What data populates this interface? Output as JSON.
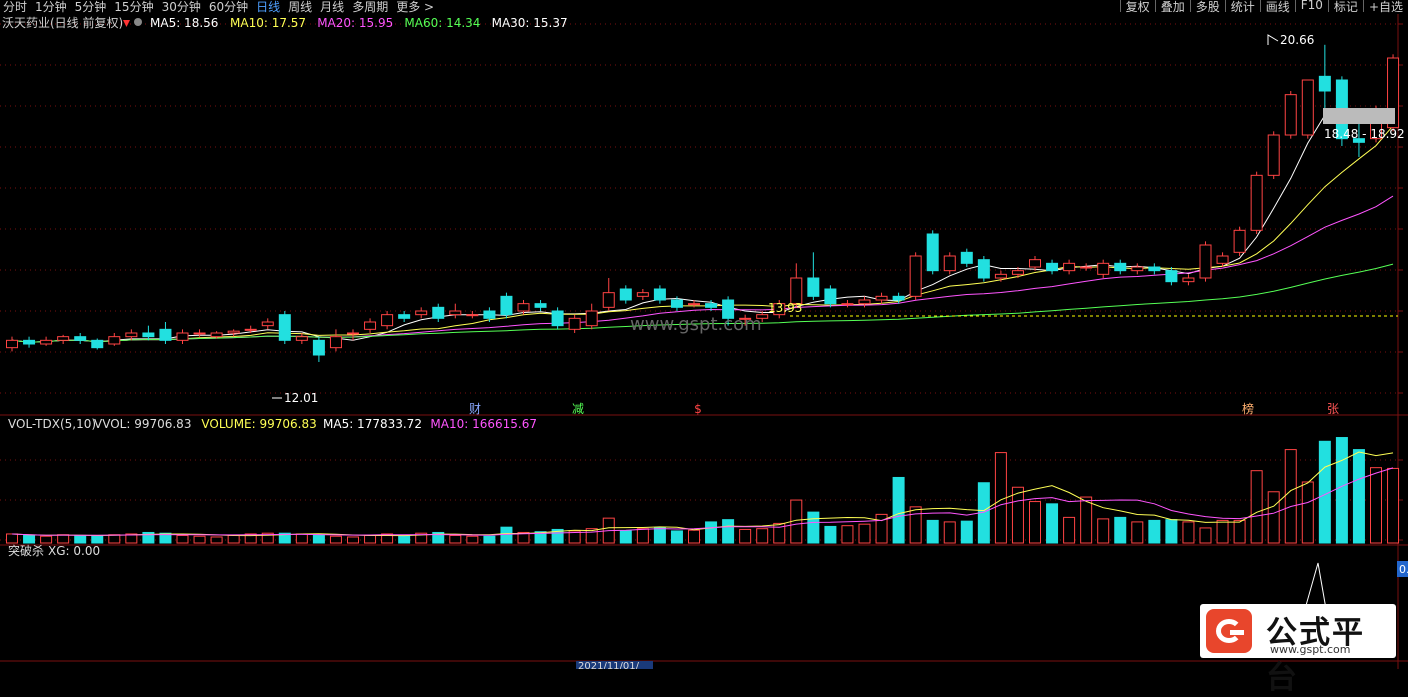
{
  "period_tabs": [
    {
      "label": "分时",
      "active": false
    },
    {
      "label": "1分钟",
      "active": false
    },
    {
      "label": "5分钟",
      "active": false
    },
    {
      "label": "15分钟",
      "active": false
    },
    {
      "label": "30分钟",
      "active": false
    },
    {
      "label": "60分钟",
      "active": false
    },
    {
      "label": "日线",
      "active": true
    },
    {
      "label": "周线",
      "active": false
    },
    {
      "label": "月线",
      "active": false
    },
    {
      "label": "多周期",
      "active": false
    },
    {
      "label": "更多 >",
      "active": false
    }
  ],
  "right_menu": [
    "复权",
    "叠加",
    "多股",
    "统计",
    "画线",
    "F10",
    "标记",
    "+自选"
  ],
  "price_panel": {
    "title": "沃天药业(日线 前复权)",
    "ma": [
      {
        "label": "MA5: 18.56",
        "color": "#ffffff"
      },
      {
        "label": "MA10: 17.57",
        "color": "#ffff55"
      },
      {
        "label": "MA20: 15.95",
        "color": "#ff55ff"
      },
      {
        "label": "MA60: 14.34",
        "color": "#55ff55"
      },
      {
        "label": "MA30: 15.37",
        "color": "#ffffff"
      }
    ],
    "high_label": "20.66",
    "low_label": "12.01",
    "mid_label": "13.93",
    "price_range_label": "18.48 - 18.92",
    "event_markers": [
      {
        "text": "财",
        "color": "#8aa8ff"
      },
      {
        "text": "减",
        "color": "#55ff55"
      },
      {
        "text": "$",
        "color": "#ff4444"
      },
      {
        "text": "榜",
        "color": "#ffb070"
      },
      {
        "text": "张",
        "color": "#ff5555"
      }
    ]
  },
  "volume_panel": {
    "indicator": "VOL-TDX(5,10)",
    "labels": [
      {
        "text": "VVOL: 99706.83",
        "color": "#dddddd"
      },
      {
        "text": "VOLUME: 99706.83",
        "color": "#ffff55"
      },
      {
        "text": "MA5: 177833.72",
        "color": "#ffffff"
      },
      {
        "text": "MA10: 166615.67",
        "color": "#ff55ff"
      }
    ]
  },
  "signal_panel": {
    "name": "突破杀",
    "value_label": "XG: 0.00",
    "right_value": "0."
  },
  "watermark": "www.gspt.com",
  "date_label": "2021/11/01/",
  "logo": {
    "title": "公式平台",
    "url": "www.gspt.com"
  },
  "colors": {
    "up": "#ff4444",
    "down": "#22e0e0",
    "ma5": "#ffffff",
    "ma10": "#ffff55",
    "ma20": "#ff55ff",
    "ma60": "#55ff55",
    "grid": "#7a1010",
    "dash": "#ffff00"
  },
  "chart_data": {
    "type": "candlestick",
    "price_range": [
      11.0,
      21.5
    ],
    "candles": [
      {
        "o": 12.4,
        "c": 12.6,
        "h": 12.7,
        "l": 12.3
      },
      {
        "o": 12.6,
        "c": 12.5,
        "h": 12.7,
        "l": 12.4
      },
      {
        "o": 12.5,
        "c": 12.6,
        "h": 12.7,
        "l": 12.45
      },
      {
        "o": 12.6,
        "c": 12.7,
        "h": 12.75,
        "l": 12.5
      },
      {
        "o": 12.7,
        "c": 12.6,
        "h": 12.8,
        "l": 12.5
      },
      {
        "o": 12.6,
        "c": 12.4,
        "h": 12.65,
        "l": 12.35
      },
      {
        "o": 12.5,
        "c": 12.7,
        "h": 12.8,
        "l": 12.45
      },
      {
        "o": 12.7,
        "c": 12.8,
        "h": 12.9,
        "l": 12.6
      },
      {
        "o": 12.8,
        "c": 12.7,
        "h": 13.0,
        "l": 12.6
      },
      {
        "o": 12.9,
        "c": 12.6,
        "h": 13.1,
        "l": 12.5
      },
      {
        "o": 12.6,
        "c": 12.8,
        "h": 12.9,
        "l": 12.5
      },
      {
        "o": 12.8,
        "c": 12.8,
        "h": 12.9,
        "l": 12.7
      },
      {
        "o": 12.7,
        "c": 12.8,
        "h": 12.85,
        "l": 12.65
      },
      {
        "o": 12.8,
        "c": 12.85,
        "h": 12.9,
        "l": 12.7
      },
      {
        "o": 12.9,
        "c": 12.9,
        "h": 13.0,
        "l": 12.8
      },
      {
        "o": 13.0,
        "c": 13.1,
        "h": 13.2,
        "l": 12.9
      },
      {
        "o": 13.3,
        "c": 12.6,
        "h": 13.4,
        "l": 12.5
      },
      {
        "o": 12.6,
        "c": 12.7,
        "h": 12.8,
        "l": 12.5
      },
      {
        "o": 12.6,
        "c": 12.2,
        "h": 12.7,
        "l": 12.01
      },
      {
        "o": 12.4,
        "c": 12.7,
        "h": 12.9,
        "l": 12.3
      },
      {
        "o": 12.8,
        "c": 12.8,
        "h": 12.9,
        "l": 12.6
      },
      {
        "o": 12.9,
        "c": 13.1,
        "h": 13.2,
        "l": 12.8
      },
      {
        "o": 13.0,
        "c": 13.3,
        "h": 13.4,
        "l": 12.9
      },
      {
        "o": 13.3,
        "c": 13.2,
        "h": 13.4,
        "l": 13.1
      },
      {
        "o": 13.3,
        "c": 13.4,
        "h": 13.5,
        "l": 13.2
      },
      {
        "o": 13.5,
        "c": 13.2,
        "h": 13.6,
        "l": 13.1
      },
      {
        "o": 13.3,
        "c": 13.4,
        "h": 13.6,
        "l": 13.2
      },
      {
        "o": 13.3,
        "c": 13.3,
        "h": 13.4,
        "l": 13.2
      },
      {
        "o": 13.4,
        "c": 13.2,
        "h": 13.5,
        "l": 13.1
      },
      {
        "o": 13.8,
        "c": 13.3,
        "h": 13.9,
        "l": 13.2
      },
      {
        "o": 13.4,
        "c": 13.6,
        "h": 13.7,
        "l": 13.3
      },
      {
        "o": 13.6,
        "c": 13.5,
        "h": 13.7,
        "l": 13.4
      },
      {
        "o": 13.4,
        "c": 13.0,
        "h": 13.5,
        "l": 12.9
      },
      {
        "o": 12.9,
        "c": 13.2,
        "h": 13.3,
        "l": 12.8
      },
      {
        "o": 13.0,
        "c": 13.4,
        "h": 13.6,
        "l": 12.9
      },
      {
        "o": 13.5,
        "c": 13.9,
        "h": 14.3,
        "l": 13.4
      },
      {
        "o": 14.0,
        "c": 13.7,
        "h": 14.1,
        "l": 13.6
      },
      {
        "o": 13.8,
        "c": 13.9,
        "h": 14.0,
        "l": 13.7
      },
      {
        "o": 14.0,
        "c": 13.7,
        "h": 14.1,
        "l": 13.6
      },
      {
        "o": 13.7,
        "c": 13.5,
        "h": 13.8,
        "l": 13.4
      },
      {
        "o": 13.6,
        "c": 13.6,
        "h": 13.7,
        "l": 13.5
      },
      {
        "o": 13.6,
        "c": 13.5,
        "h": 13.7,
        "l": 13.4
      },
      {
        "o": 13.7,
        "c": 13.2,
        "h": 13.8,
        "l": 13.0
      },
      {
        "o": 13.2,
        "c": 13.2,
        "h": 13.3,
        "l": 13.0
      },
      {
        "o": 13.2,
        "c": 13.3,
        "h": 13.4,
        "l": 13.1
      },
      {
        "o": 13.3,
        "c": 13.6,
        "h": 13.7,
        "l": 13.2
      },
      {
        "o": 13.6,
        "c": 14.3,
        "h": 14.7,
        "l": 13.5
      },
      {
        "o": 14.3,
        "c": 13.8,
        "h": 15.0,
        "l": 13.7
      },
      {
        "o": 14.0,
        "c": 13.6,
        "h": 14.1,
        "l": 13.5
      },
      {
        "o": 13.6,
        "c": 13.6,
        "h": 13.7,
        "l": 13.5
      },
      {
        "o": 13.6,
        "c": 13.7,
        "h": 13.8,
        "l": 13.5
      },
      {
        "o": 13.7,
        "c": 13.8,
        "h": 13.9,
        "l": 13.6
      },
      {
        "o": 13.8,
        "c": 13.7,
        "h": 13.9,
        "l": 13.6
      },
      {
        "o": 13.8,
        "c": 14.9,
        "h": 15.0,
        "l": 13.7
      },
      {
        "o": 15.5,
        "c": 14.5,
        "h": 15.6,
        "l": 14.4
      },
      {
        "o": 14.5,
        "c": 14.9,
        "h": 15.0,
        "l": 14.4
      },
      {
        "o": 15.0,
        "c": 14.7,
        "h": 15.1,
        "l": 14.6
      },
      {
        "o": 14.8,
        "c": 14.3,
        "h": 14.9,
        "l": 14.2
      },
      {
        "o": 14.3,
        "c": 14.4,
        "h": 14.5,
        "l": 14.2
      },
      {
        "o": 14.4,
        "c": 14.5,
        "h": 14.6,
        "l": 14.3
      },
      {
        "o": 14.6,
        "c": 14.8,
        "h": 14.9,
        "l": 14.5
      },
      {
        "o": 14.7,
        "c": 14.5,
        "h": 14.8,
        "l": 14.4
      },
      {
        "o": 14.5,
        "c": 14.7,
        "h": 14.8,
        "l": 14.4
      },
      {
        "o": 14.6,
        "c": 14.6,
        "h": 14.7,
        "l": 14.5
      },
      {
        "o": 14.4,
        "c": 14.7,
        "h": 14.8,
        "l": 14.3
      },
      {
        "o": 14.7,
        "c": 14.5,
        "h": 14.8,
        "l": 14.4
      },
      {
        "o": 14.5,
        "c": 14.6,
        "h": 14.7,
        "l": 14.4
      },
      {
        "o": 14.6,
        "c": 14.5,
        "h": 14.7,
        "l": 14.4
      },
      {
        "o": 14.5,
        "c": 14.2,
        "h": 14.6,
        "l": 14.1
      },
      {
        "o": 14.2,
        "c": 14.3,
        "h": 14.4,
        "l": 14.1
      },
      {
        "o": 14.3,
        "c": 15.2,
        "h": 15.3,
        "l": 14.2
      },
      {
        "o": 14.7,
        "c": 14.9,
        "h": 15.0,
        "l": 14.6
      },
      {
        "o": 15.0,
        "c": 15.6,
        "h": 15.7,
        "l": 14.9
      },
      {
        "o": 15.6,
        "c": 17.1,
        "h": 17.2,
        "l": 15.5
      },
      {
        "o": 17.1,
        "c": 18.2,
        "h": 18.3,
        "l": 17.0
      },
      {
        "o": 18.2,
        "c": 19.3,
        "h": 19.4,
        "l": 18.1
      },
      {
        "o": 18.2,
        "c": 19.7,
        "h": 19.7,
        "l": 18.1
      },
      {
        "o": 19.8,
        "c": 19.4,
        "h": 20.66,
        "l": 18.7
      },
      {
        "o": 19.7,
        "c": 18.1,
        "h": 19.8,
        "l": 17.9
      },
      {
        "o": 18.1,
        "c": 18.0,
        "h": 18.5,
        "l": 17.6
      },
      {
        "o": 18.1,
        "c": 18.8,
        "h": 19.0,
        "l": 18.0
      },
      {
        "o": 18.4,
        "c": 20.3,
        "h": 20.4,
        "l": 18.3
      }
    ],
    "volumes": [
      1.2,
      1.0,
      0.9,
      1.1,
      1.0,
      1.0,
      1.1,
      1.2,
      1.4,
      1.3,
      1.0,
      0.9,
      0.8,
      1.0,
      1.2,
      1.3,
      1.3,
      1.2,
      1.1,
      0.9,
      0.8,
      1.0,
      1.2,
      1.0,
      1.3,
      1.4,
      1.0,
      0.9,
      0.9,
      2.1,
      1.4,
      1.5,
      1.8,
      1.6,
      1.9,
      3.3,
      1.6,
      1.9,
      2.0,
      1.6,
      1.7,
      2.8,
      3.1,
      1.8,
      1.9,
      2.6,
      5.7,
      4.1,
      2.2,
      2.3,
      2.5,
      3.8,
      8.7,
      4.8,
      3.0,
      2.8,
      2.9,
      8.0,
      12.0,
      7.4,
      5.5,
      5.2,
      3.4,
      6.1,
      3.2,
      3.4,
      2.8,
      3.0,
      3.1,
      2.8,
      2.0,
      3.0,
      3.0,
      9.6,
      6.8,
      12.4,
      8.1,
      13.5,
      14.0,
      12.4,
      10.0,
      9.9
    ],
    "volume_max": 15.0
  }
}
